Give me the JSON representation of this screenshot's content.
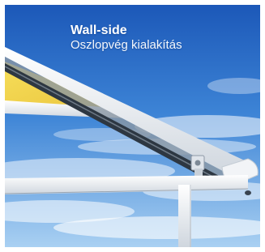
{
  "photo": {
    "subject": "awning-wall-side-mount",
    "colors": {
      "sky_top": "#1f5fbf",
      "sky_bottom": "#9cc8ef",
      "canopy": "#f2d24a",
      "frame": "#f4f6f8"
    }
  },
  "caption": {
    "title": "Wall-side",
    "subtitle": "Oszlopvég kialakítás"
  }
}
